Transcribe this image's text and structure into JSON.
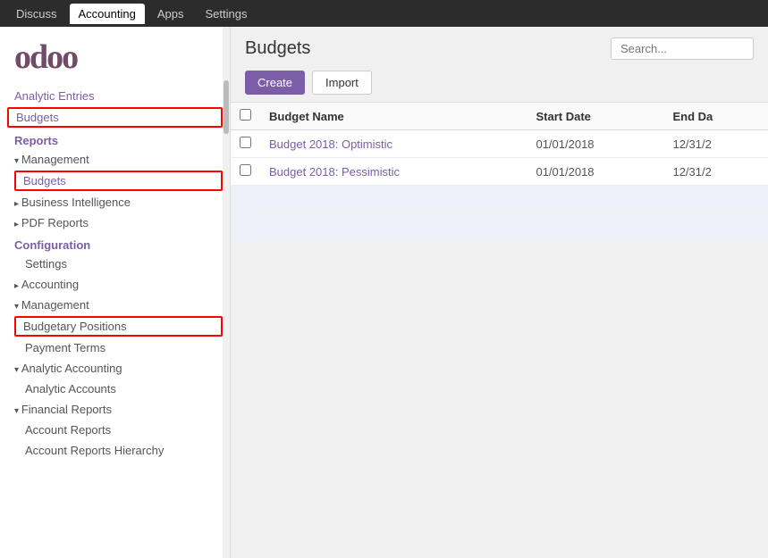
{
  "topnav": {
    "items": [
      {
        "label": "Discuss",
        "active": false
      },
      {
        "label": "Accounting",
        "active": true
      },
      {
        "label": "Apps",
        "active": false
      },
      {
        "label": "Settings",
        "active": false
      }
    ]
  },
  "sidebar": {
    "logo_text": "odoo",
    "items": [
      {
        "type": "link",
        "label": "Analytic Entries",
        "highlighted": false
      },
      {
        "type": "link-highlighted",
        "label": "Budgets",
        "highlighted": true
      },
      {
        "type": "section-header",
        "label": "Reports"
      },
      {
        "type": "group-open",
        "label": "Management"
      },
      {
        "type": "link-highlighted-indent",
        "label": "Budgets",
        "highlighted": true
      },
      {
        "type": "group-closed",
        "label": "Business Intelligence"
      },
      {
        "type": "group-closed",
        "label": "PDF Reports"
      },
      {
        "type": "section-header",
        "label": "Configuration"
      },
      {
        "type": "plain-indent",
        "label": "Settings"
      },
      {
        "type": "group-closed",
        "label": "Accounting"
      },
      {
        "type": "group-open",
        "label": "Management"
      },
      {
        "type": "link-highlighted-indent",
        "label": "Budgetary Positions",
        "highlighted": true
      },
      {
        "type": "plain-indent",
        "label": "Payment Terms"
      },
      {
        "type": "group-open",
        "label": "Analytic Accounting"
      },
      {
        "type": "plain-indent",
        "label": "Analytic Accounts"
      },
      {
        "type": "group-open",
        "label": "Financial Reports"
      },
      {
        "type": "plain-indent",
        "label": "Account Reports"
      },
      {
        "type": "plain-indent",
        "label": "Account Reports Hierarchy"
      }
    ]
  },
  "main": {
    "title": "Budgets",
    "search_placeholder": "Search...",
    "create_label": "Create",
    "import_label": "Import",
    "table": {
      "columns": [
        "Budget Name",
        "Start Date",
        "End Da"
      ],
      "rows": [
        {
          "name": "Budget 2018: Optimistic",
          "start_date": "01/01/2018",
          "end_date": "12/31/2"
        },
        {
          "name": "Budget 2018: Pessimistic",
          "start_date": "01/01/2018",
          "end_date": "12/31/2"
        }
      ]
    }
  }
}
